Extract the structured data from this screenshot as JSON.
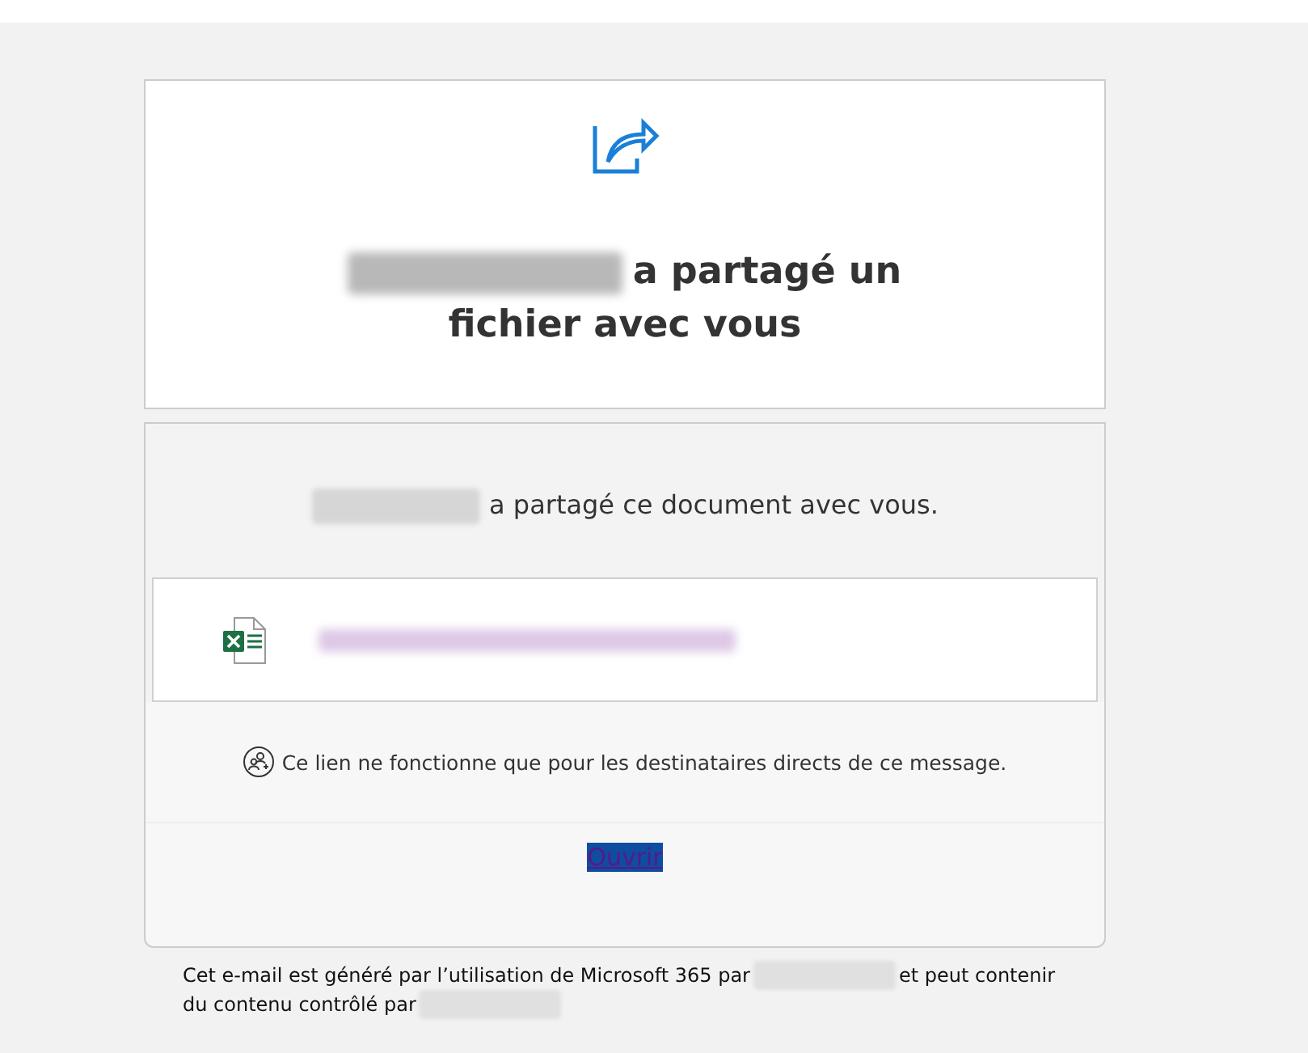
{
  "header": {
    "title_lines": [
      [
        {
          "kind": "redaction"
        },
        {
          "kind": "text",
          "text": "a partagé un"
        }
      ],
      [
        {
          "kind": "text",
          "text": "fichier avec vous"
        }
      ]
    ]
  },
  "shared_line": [
    {
      "kind": "redaction"
    },
    {
      "kind": "text",
      "text": "a partagé ce document avec vous."
    }
  ],
  "file": {
    "kind": "redaction"
  },
  "notice": "Ce lien ne fonctionne que pour les destinataires directs de ce message.",
  "open_link": {
    "label": "Ouvrir",
    "selected": true
  },
  "footer": [
    [
      {
        "kind": "text",
        "text": "Cet e-mail est généré par l’utilisation de Microsoft 365 par"
      },
      {
        "kind": "redaction"
      },
      {
        "kind": "text",
        "text": "et peut contenir"
      }
    ],
    [
      {
        "kind": "text",
        "text": "du contenu contrôlé par"
      },
      {
        "kind": "redaction"
      }
    ]
  ]
}
